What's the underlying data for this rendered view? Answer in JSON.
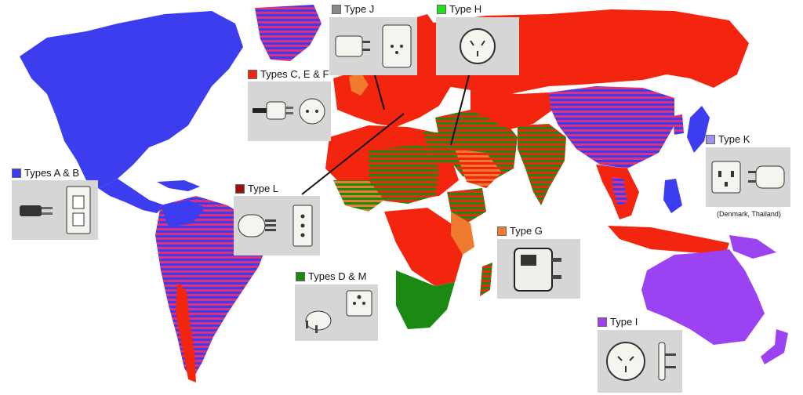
{
  "colors": {
    "ocean": "#ffffff",
    "type_ab": "#3d3df0",
    "type_cef": "#f4250f",
    "type_dm": "#1a8a12",
    "type_g": "#f07a2e",
    "type_h": "#22e022",
    "type_i": "#9b43f2",
    "type_j": "#888888",
    "type_k": "#a090f0",
    "type_l": "#9a1010",
    "border": "#ffffff",
    "legend_box": "#d6d6d6",
    "pointer_line": "#111111"
  },
  "legend": {
    "types_ab": "Types A & B",
    "types_cef": "Types C, E & F",
    "type_j": "Type J",
    "type_h": "Type H",
    "type_k": "Type K",
    "type_k_note": "(Denmark, Thailand)",
    "type_l": "Type L",
    "types_dm": "Types D & M",
    "type_g": "Type G",
    "type_i": "Type I"
  },
  "icons": {
    "types_ab": [
      "plug-a-icon",
      "outlet-ab-icon"
    ],
    "types_cef": [
      "plug-cef-icon",
      "outlet-cef-icon"
    ],
    "type_j": [
      "plug-j-icon",
      "outlet-j-icon"
    ],
    "type_h": [
      "outlet-h-icon"
    ],
    "type_k": [
      "outlet-k-icon",
      "plug-k-icon"
    ],
    "type_l": [
      "plug-l-icon",
      "outlet-l-icon"
    ],
    "types_dm": [
      "plug-d-icon",
      "outlet-dm-icon"
    ],
    "type_g": [
      "plug-g-icon"
    ],
    "type_i": [
      "outlet-i-icon",
      "plug-i-icon"
    ]
  }
}
